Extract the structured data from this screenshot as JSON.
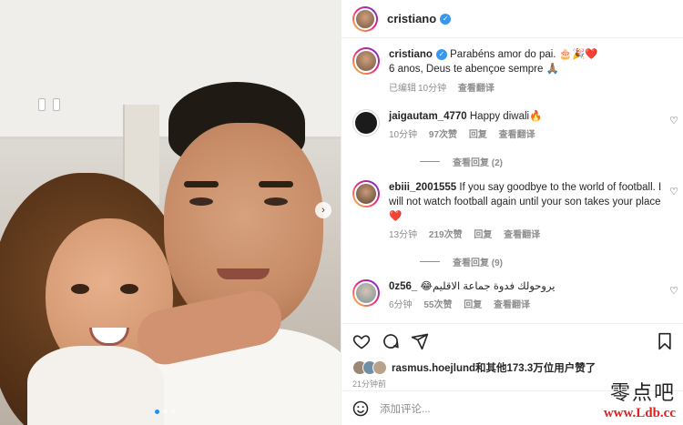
{
  "header": {
    "username": "cristiano"
  },
  "caption": {
    "username": "cristiano",
    "text_line1": "Parabéns amor do pai. 🎂🎉❤️",
    "text_line2": "6 anos, Deus te abençoe sempre 🙏🏽",
    "edited": "已编辑",
    "time": "10分钟",
    "translate": "查看翻译"
  },
  "comments": [
    {
      "username": "jaigautam_4770",
      "text": "Happy diwali🔥",
      "time": "10分钟",
      "likes": "97次赞",
      "reply": "回复",
      "translate": "查看翻译",
      "view_replies": "查看回复 (2)"
    },
    {
      "username": "ebiii_2001555",
      "text": "If you say goodbye to the world of football. I will not watch football again until your son takes your place ❤️",
      "time": "13分钟",
      "likes": "219次赞",
      "reply": "回复",
      "translate": "查看翻译",
      "view_replies": "查看回复 (9)"
    },
    {
      "username": "0z56_",
      "text": "يروحولك فدوة جماعة الاقليم😂",
      "time": "6分钟",
      "likes": "55次赞",
      "reply": "回复",
      "translate": "查看翻译"
    }
  ],
  "actions": {
    "likes_text": "rasmus.hoejlund和其他173.3万位用户赞了",
    "time_ago": "21分钟前",
    "add_comment_placeholder": "添加评论..."
  },
  "watermark": {
    "cn": "零点吧",
    "url": "www.Ldb.cc"
  },
  "icons": [
    "verified-icon",
    "heart-icon",
    "comment-icon",
    "share-icon",
    "bookmark-icon",
    "smile-icon",
    "chevron-right-icon"
  ],
  "colors": {
    "verified": "#3897f0",
    "carousel_active_dot": "#1f8ef1",
    "watermark_url": "#dd2222"
  }
}
